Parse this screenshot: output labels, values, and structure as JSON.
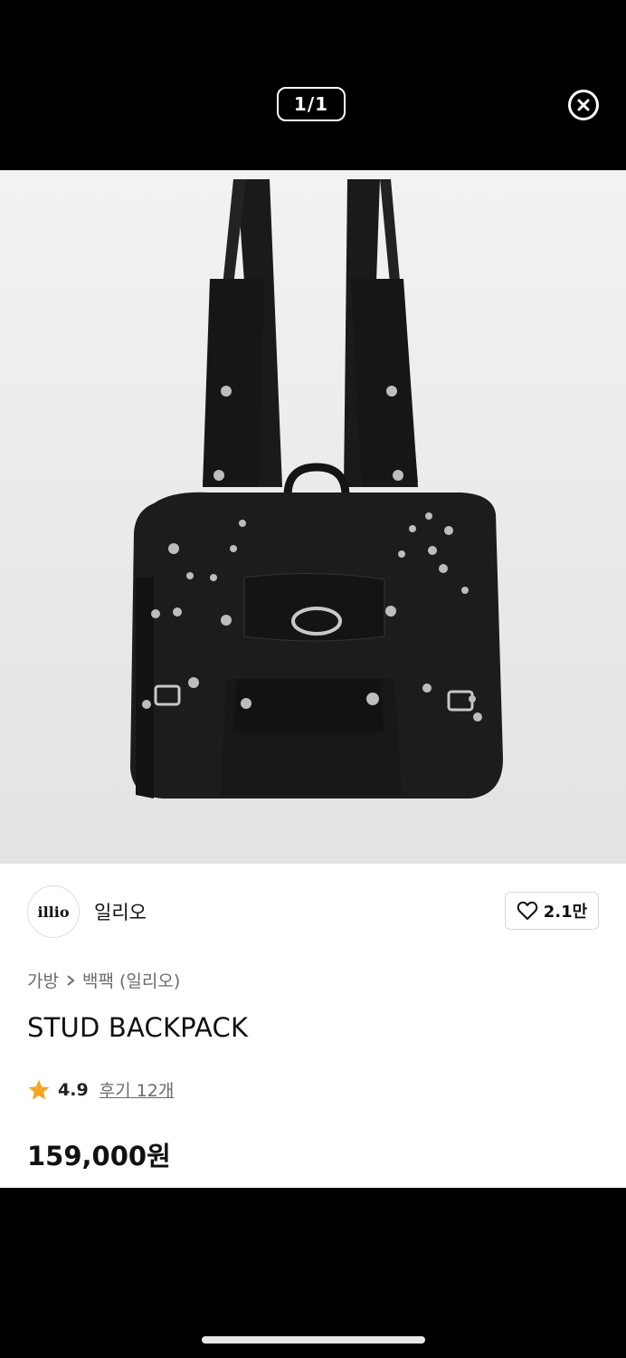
{
  "viewer": {
    "counter": "1/1"
  },
  "product": {
    "brand_logo_text": "illio",
    "brand_name": "일리오",
    "like_count": "2.1만",
    "breadcrumb": [
      "가방",
      "백팩 (일리오)"
    ],
    "title": "STUD BACKPACK",
    "rating": "4.9",
    "reviews": "후기 12개",
    "price": "159,000원"
  },
  "colors": {
    "star": "#f5a623",
    "background": "#000000"
  }
}
